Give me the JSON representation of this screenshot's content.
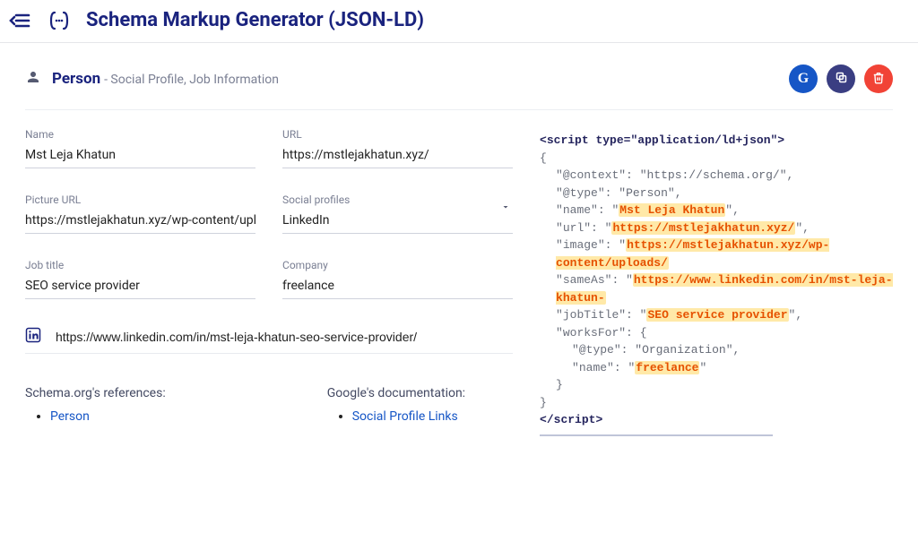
{
  "header": {
    "title": "Schema Markup Generator (JSON-LD)"
  },
  "subheader": {
    "type": "Person",
    "desc": "- Social Profile, Job Information"
  },
  "actions": {
    "google": "G",
    "copy_icon": "copy",
    "delete_icon": "trash"
  },
  "fields": {
    "name": {
      "label": "Name",
      "value": "Mst Leja Khatun"
    },
    "url": {
      "label": "URL",
      "value": "https://mstlejakhatun.xyz/"
    },
    "picture": {
      "label": "Picture URL",
      "value": "https://mstlejakhatun.xyz/wp-content/uplo"
    },
    "social": {
      "label": "Social profiles",
      "value": "LinkedIn"
    },
    "jobtitle": {
      "label": "Job title",
      "value": "SEO service provider"
    },
    "company": {
      "label": "Company",
      "value": "freelance"
    },
    "social_url": {
      "value": "https://www.linkedin.com/in/mst-leja-khatun-seo-service-provider/"
    }
  },
  "refs": {
    "schema_title": "Schema.org's references:",
    "schema_link": "Person",
    "google_title": "Google's documentation:",
    "google_link": "Social Profile Links"
  },
  "code": {
    "open": "<script type=\"application/ld+json\">",
    "brace_open": "{",
    "ctx_key": "\"@context\":",
    "ctx_val": "\"https://schema.org/\",",
    "type_key": "\"@type\":",
    "type_val": "\"Person\",",
    "name_key": "\"name\":",
    "name_val": "Mst Leja Khatun",
    "url_key": "\"url\":",
    "url_val": "https://mstlejakhatun.xyz/",
    "img_key": "\"image\":",
    "img_val": "https://mstlejakhatun.xyz/wp-content/uploads/",
    "same_key": "\"sameAs\":",
    "same_val": "https://www.linkedin.com/in/mst-leja-khatun-",
    "job_key": "\"jobTitle\":",
    "job_val": "SEO service provider",
    "wf_key": "\"worksFor\":",
    "wf_val": "{",
    "org_type_key": "\"@type\":",
    "org_type_val": "\"Organization\",",
    "org_name_key": "\"name\":",
    "org_name_val": "freelance",
    "brace_close_inner": "}",
    "brace_close": "}",
    "close": "</script>"
  }
}
